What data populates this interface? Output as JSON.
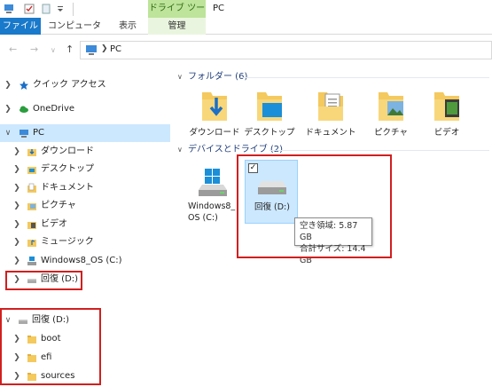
{
  "window": {
    "title": "PC",
    "tool_context": "ドライブ ツール"
  },
  "ribbon": {
    "tabs": [
      {
        "label": "ファイル",
        "active": true
      },
      {
        "label": "コンピューター"
      },
      {
        "label": "表示"
      },
      {
        "label": "管理"
      }
    ]
  },
  "address": {
    "path": "PC"
  },
  "navpane": {
    "items": [
      {
        "label": "クイック アクセス",
        "icon": "star-icon"
      },
      {
        "label": "OneDrive",
        "icon": "cloud-icon"
      },
      {
        "label": "PC",
        "icon": "computer-icon",
        "selected": true
      },
      {
        "label": "ダウンロード",
        "icon": "download-folder-icon"
      },
      {
        "label": "デスクトップ",
        "icon": "desktop-folder-icon"
      },
      {
        "label": "ドキュメント",
        "icon": "documents-folder-icon"
      },
      {
        "label": "ピクチャ",
        "icon": "pictures-folder-icon"
      },
      {
        "label": "ビデオ",
        "icon": "videos-folder-icon"
      },
      {
        "label": "ミュージック",
        "icon": "music-folder-icon"
      },
      {
        "label": "Windows8_OS (C:)",
        "icon": "windows-drive-icon"
      },
      {
        "label": "回復 (D:)",
        "icon": "drive-icon"
      }
    ],
    "recovery_tree": {
      "root": "回復 (D:)",
      "children": [
        "boot",
        "efi",
        "sources"
      ]
    }
  },
  "content": {
    "folders_header": "フォルダー (6)",
    "folders": [
      "ダウンロード",
      "デスクトップ",
      "ドキュメント",
      "ピクチャ",
      "ビデオ"
    ],
    "drives_header": "デバイスとドライブ (2)",
    "drives": [
      {
        "label": "Windows8_ OS (C:)"
      },
      {
        "label": "回復 (D:)",
        "selected": true,
        "checked": "✓"
      }
    ],
    "tooltip": {
      "free": "空き領域: 5.87 GB",
      "total": "合計サイズ: 14.4 GB"
    }
  },
  "colors": {
    "accent": "#1979ca",
    "selection": "#cce8ff",
    "tool_context": "#bde49a",
    "annotation_red": "#d11f1f",
    "folder_yellow": "#f4c95d"
  }
}
